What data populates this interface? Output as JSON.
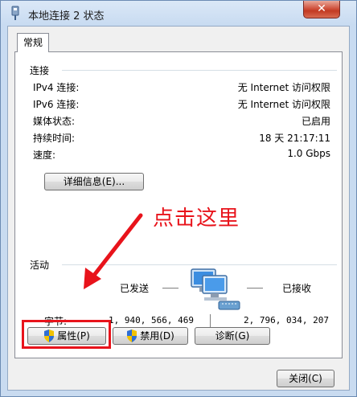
{
  "window": {
    "title": "本地连接 2 状态",
    "close_label": "✕"
  },
  "tabs": [
    {
      "label": "常规"
    }
  ],
  "connection": {
    "group_label": "连接",
    "rows": [
      {
        "label": "IPv4 连接:",
        "value": "无 Internet 访问权限"
      },
      {
        "label": "IPv6 连接:",
        "value": "无 Internet 访问权限"
      },
      {
        "label": "媒体状态:",
        "value": "已启用"
      },
      {
        "label": "持续时间:",
        "value": "18 天 21:17:11"
      },
      {
        "label": "速度:",
        "value": "1.0 Gbps"
      }
    ],
    "details_button": "详细信息(E)..."
  },
  "activity": {
    "group_label": "活动",
    "sent_label": "已发送",
    "received_label": "已接收",
    "bytes_label": "字节:",
    "bytes_sent": "1, 940, 566, 469",
    "bytes_received": "2, 796, 034, 207",
    "icon": "network-computers-icon"
  },
  "buttons": {
    "properties": "属性(P)",
    "disable": "禁用(D)",
    "diagnose": "诊断(G)",
    "close": "关闭(C)"
  },
  "annotation": {
    "text": "点击这里",
    "color": "#e8131b"
  }
}
